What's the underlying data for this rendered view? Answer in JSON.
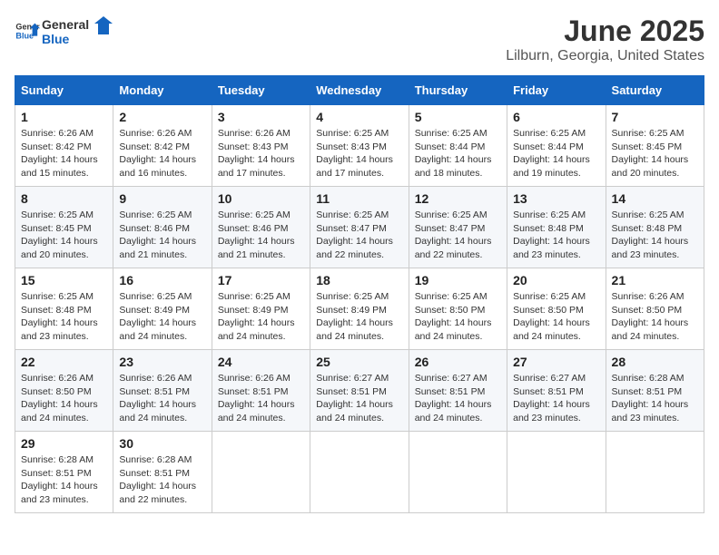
{
  "header": {
    "logo_general": "General",
    "logo_blue": "Blue",
    "month_year": "June 2025",
    "location": "Lilburn, Georgia, United States"
  },
  "calendar": {
    "days_of_week": [
      "Sunday",
      "Monday",
      "Tuesday",
      "Wednesday",
      "Thursday",
      "Friday",
      "Saturday"
    ],
    "weeks": [
      [
        {
          "day": "1",
          "sunrise": "6:26 AM",
          "sunset": "8:42 PM",
          "daylight": "14 hours and 15 minutes."
        },
        {
          "day": "2",
          "sunrise": "6:26 AM",
          "sunset": "8:42 PM",
          "daylight": "14 hours and 16 minutes."
        },
        {
          "day": "3",
          "sunrise": "6:26 AM",
          "sunset": "8:43 PM",
          "daylight": "14 hours and 17 minutes."
        },
        {
          "day": "4",
          "sunrise": "6:25 AM",
          "sunset": "8:43 PM",
          "daylight": "14 hours and 17 minutes."
        },
        {
          "day": "5",
          "sunrise": "6:25 AM",
          "sunset": "8:44 PM",
          "daylight": "14 hours and 18 minutes."
        },
        {
          "day": "6",
          "sunrise": "6:25 AM",
          "sunset": "8:44 PM",
          "daylight": "14 hours and 19 minutes."
        },
        {
          "day": "7",
          "sunrise": "6:25 AM",
          "sunset": "8:45 PM",
          "daylight": "14 hours and 20 minutes."
        }
      ],
      [
        {
          "day": "8",
          "sunrise": "6:25 AM",
          "sunset": "8:45 PM",
          "daylight": "14 hours and 20 minutes."
        },
        {
          "day": "9",
          "sunrise": "6:25 AM",
          "sunset": "8:46 PM",
          "daylight": "14 hours and 21 minutes."
        },
        {
          "day": "10",
          "sunrise": "6:25 AM",
          "sunset": "8:46 PM",
          "daylight": "14 hours and 21 minutes."
        },
        {
          "day": "11",
          "sunrise": "6:25 AM",
          "sunset": "8:47 PM",
          "daylight": "14 hours and 22 minutes."
        },
        {
          "day": "12",
          "sunrise": "6:25 AM",
          "sunset": "8:47 PM",
          "daylight": "14 hours and 22 minutes."
        },
        {
          "day": "13",
          "sunrise": "6:25 AM",
          "sunset": "8:48 PM",
          "daylight": "14 hours and 23 minutes."
        },
        {
          "day": "14",
          "sunrise": "6:25 AM",
          "sunset": "8:48 PM",
          "daylight": "14 hours and 23 minutes."
        }
      ],
      [
        {
          "day": "15",
          "sunrise": "6:25 AM",
          "sunset": "8:48 PM",
          "daylight": "14 hours and 23 minutes."
        },
        {
          "day": "16",
          "sunrise": "6:25 AM",
          "sunset": "8:49 PM",
          "daylight": "14 hours and 24 minutes."
        },
        {
          "day": "17",
          "sunrise": "6:25 AM",
          "sunset": "8:49 PM",
          "daylight": "14 hours and 24 minutes."
        },
        {
          "day": "18",
          "sunrise": "6:25 AM",
          "sunset": "8:49 PM",
          "daylight": "14 hours and 24 minutes."
        },
        {
          "day": "19",
          "sunrise": "6:25 AM",
          "sunset": "8:50 PM",
          "daylight": "14 hours and 24 minutes."
        },
        {
          "day": "20",
          "sunrise": "6:25 AM",
          "sunset": "8:50 PM",
          "daylight": "14 hours and 24 minutes."
        },
        {
          "day": "21",
          "sunrise": "6:26 AM",
          "sunset": "8:50 PM",
          "daylight": "14 hours and 24 minutes."
        }
      ],
      [
        {
          "day": "22",
          "sunrise": "6:26 AM",
          "sunset": "8:50 PM",
          "daylight": "14 hours and 24 minutes."
        },
        {
          "day": "23",
          "sunrise": "6:26 AM",
          "sunset": "8:51 PM",
          "daylight": "14 hours and 24 minutes."
        },
        {
          "day": "24",
          "sunrise": "6:26 AM",
          "sunset": "8:51 PM",
          "daylight": "14 hours and 24 minutes."
        },
        {
          "day": "25",
          "sunrise": "6:27 AM",
          "sunset": "8:51 PM",
          "daylight": "14 hours and 24 minutes."
        },
        {
          "day": "26",
          "sunrise": "6:27 AM",
          "sunset": "8:51 PM",
          "daylight": "14 hours and 24 minutes."
        },
        {
          "day": "27",
          "sunrise": "6:27 AM",
          "sunset": "8:51 PM",
          "daylight": "14 hours and 23 minutes."
        },
        {
          "day": "28",
          "sunrise": "6:28 AM",
          "sunset": "8:51 PM",
          "daylight": "14 hours and 23 minutes."
        }
      ],
      [
        {
          "day": "29",
          "sunrise": "6:28 AM",
          "sunset": "8:51 PM",
          "daylight": "14 hours and 23 minutes."
        },
        {
          "day": "30",
          "sunrise": "6:28 AM",
          "sunset": "8:51 PM",
          "daylight": "14 hours and 22 minutes."
        },
        null,
        null,
        null,
        null,
        null
      ]
    ],
    "labels": {
      "sunrise": "Sunrise:",
      "sunset": "Sunset:",
      "daylight": "Daylight:"
    }
  }
}
